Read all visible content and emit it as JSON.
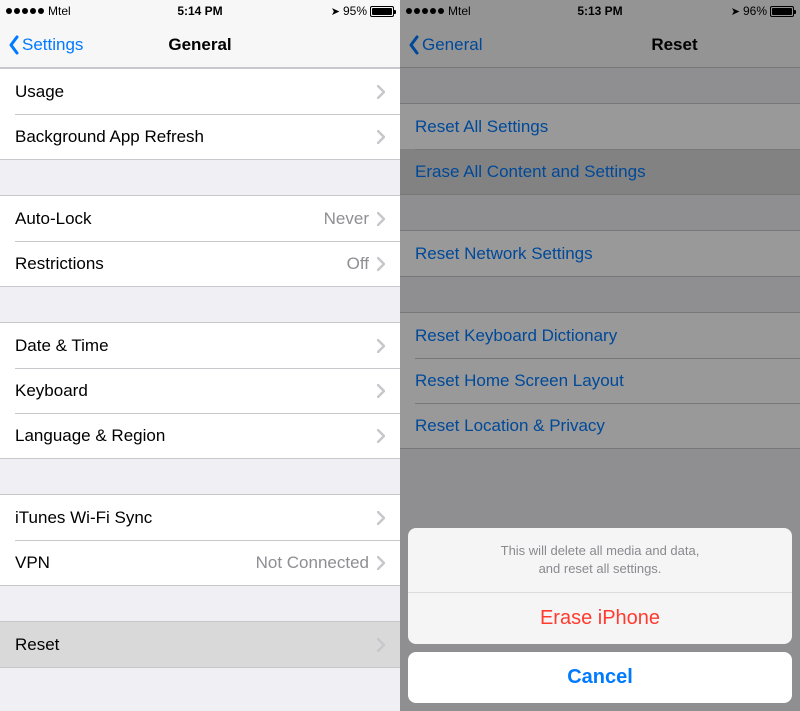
{
  "left": {
    "status": {
      "carrier": "Mtel",
      "time": "5:14 PM",
      "battery": "95%"
    },
    "nav": {
      "back": "Settings",
      "title": "General"
    },
    "groups": [
      {
        "rows": [
          {
            "label": "Usage"
          },
          {
            "label": "Background App Refresh"
          }
        ]
      },
      {
        "rows": [
          {
            "label": "Auto-Lock",
            "value": "Never"
          },
          {
            "label": "Restrictions",
            "value": "Off"
          }
        ]
      },
      {
        "rows": [
          {
            "label": "Date & Time"
          },
          {
            "label": "Keyboard"
          },
          {
            "label": "Language & Region"
          }
        ]
      },
      {
        "rows": [
          {
            "label": "iTunes Wi-Fi Sync"
          },
          {
            "label": "VPN",
            "value": "Not Connected"
          }
        ]
      },
      {
        "rows": [
          {
            "label": "Reset",
            "selected": true
          }
        ]
      }
    ]
  },
  "right": {
    "status": {
      "carrier": "Mtel",
      "time": "5:13 PM",
      "battery": "96%"
    },
    "nav": {
      "back": "General",
      "title": "Reset"
    },
    "groups": [
      {
        "rows": [
          {
            "label": "Reset All Settings"
          },
          {
            "label": "Erase All Content and Settings",
            "selected": true
          }
        ]
      },
      {
        "rows": [
          {
            "label": "Reset Network Settings"
          }
        ]
      },
      {
        "rows": [
          {
            "label": "Reset Keyboard Dictionary"
          },
          {
            "label": "Reset Home Screen Layout"
          },
          {
            "label": "Reset Location & Privacy"
          }
        ]
      }
    ],
    "sheet": {
      "message": "This will delete all media and data,\nand reset all settings.",
      "action": "Erase iPhone",
      "cancel": "Cancel"
    }
  }
}
